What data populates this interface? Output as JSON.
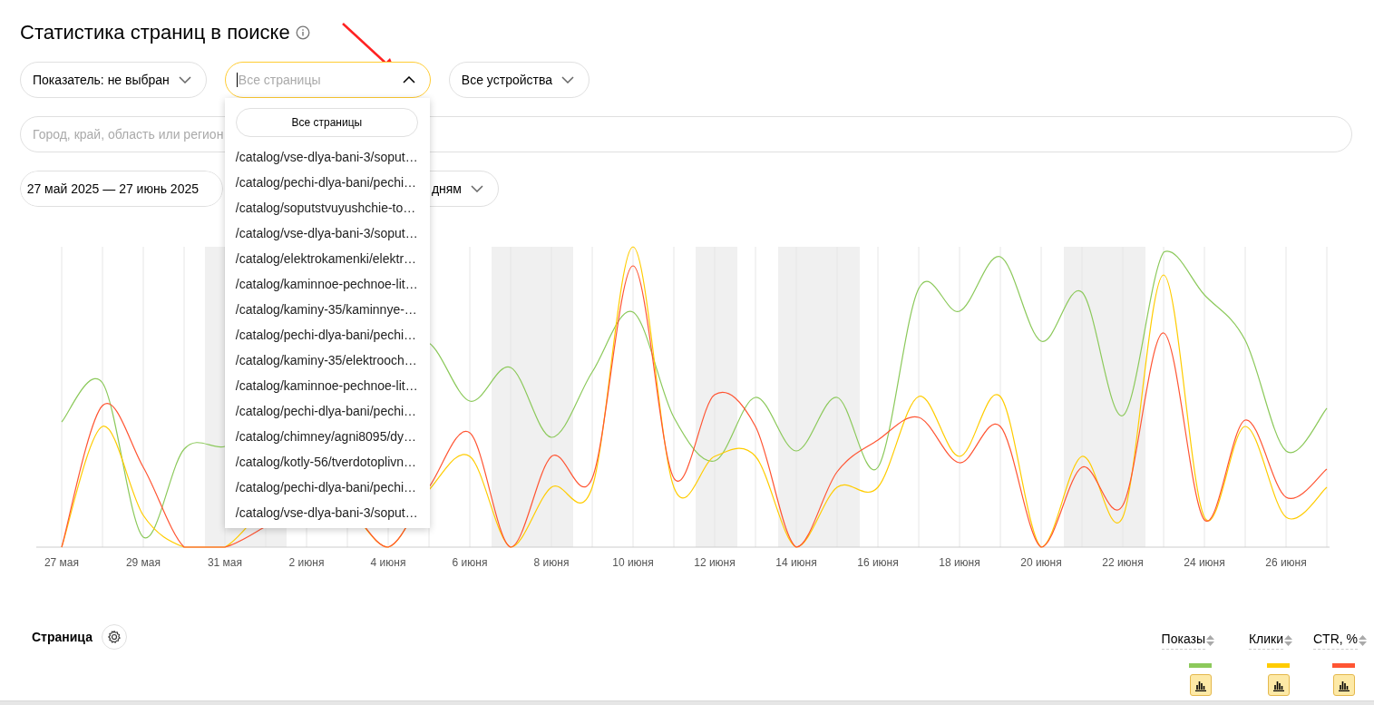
{
  "title": "Статистика страниц в поиске",
  "filters": {
    "metric": {
      "label": "Показатель: не выбран"
    },
    "pages": {
      "placeholder": "Все страницы",
      "expanded": true
    },
    "devices": {
      "label": "Все устройства"
    }
  },
  "pages_dropdown": {
    "all_button": "Все страницы",
    "options": [
      "/catalog/vse-dlya-bani-3/soput…",
      "/catalog/pechi-dlya-bani/pechi…",
      "/catalog/soputstvuyushchie-to…",
      "/catalog/vse-dlya-bani-3/soput…",
      "/catalog/elektrokamenki/elektr…",
      "/catalog/kaminnoe-pechnoe-lit…",
      "/catalog/kaminy-35/kaminnye-…",
      "/catalog/pechi-dlya-bani/pechi…",
      "/catalog/kaminy-35/elektrooch…",
      "/catalog/kaminnoe-pechnoe-lit…",
      "/catalog/pechi-dlya-bani/pechi…",
      "/catalog/chimney/agni8095/dy…",
      "/catalog/kotly-56/tverdotoplivn…",
      "/catalog/pechi-dlya-bani/pechi…",
      "/catalog/vse-dlya-bani-3/soput…"
    ]
  },
  "region": {
    "placeholder": "Город, край, область или регион"
  },
  "date_range": {
    "label": "27 май 2025 — 27 июнь 2025"
  },
  "grouping": {
    "label": "дням"
  },
  "chart": {
    "x_labels": [
      "27 мая",
      "29 мая",
      "31 мая",
      "2 июня",
      "4 июня",
      "6 июня",
      "8 июня",
      "10 июня",
      "12 июня",
      "14 июня",
      "16 июня",
      "18 июня",
      "20 июня",
      "22 июня",
      "24 июня",
      "26 июня"
    ]
  },
  "table": {
    "first_column": "Страница",
    "columns": [
      {
        "label": "Показы",
        "color": "#8cc95b"
      },
      {
        "label": "Клики",
        "color": "#ffcc00"
      },
      {
        "label": "CTR, %",
        "color": "#ff5533"
      }
    ]
  }
}
